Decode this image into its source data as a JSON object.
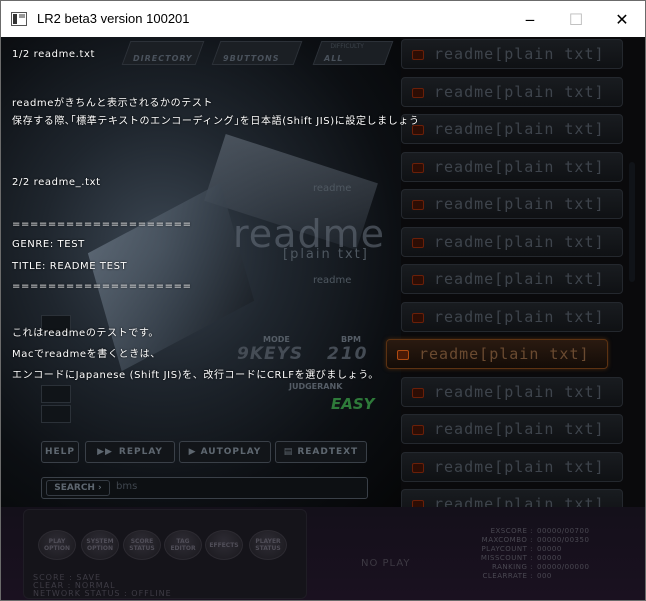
{
  "window": {
    "title": "LR2 beta3 version 100201",
    "minimize_glyph": "‒",
    "maximize_glyph": "☐",
    "close_glyph": "✕"
  },
  "header_tabs": [
    {
      "small": "",
      "label": "DIRECTORY"
    },
    {
      "small": "",
      "label": "9BUTTONS"
    },
    {
      "small": "DIFFICULTY",
      "label": "ALL"
    }
  ],
  "overlay_lines": [
    "1/2 readme.txt",
    "readmeがきちんと表示されるかのテスト",
    "保存する際､｢標準テキストのエンコーディング｣を日本語(Shift JIS)に設定しましょう",
    "2/2 readme_.txt",
    "====================",
    "GENRE: TEST",
    "TITLE: README TEST",
    "====================",
    "これはreadmeのテストです。",
    "Macでreadmeを書くときは、",
    "エンコードにJapanese (Shift JIS)を、改行コードにCRLFを選びましょう。"
  ],
  "song_info": {
    "artist_small": "readme",
    "title": "readme",
    "subtitle": "[plain txt]",
    "genre_small": "readme",
    "mode_label": "MODE",
    "mode_value": "9KEYS",
    "bpm_label": "BPM",
    "bpm_value": "210",
    "judge_label": "JUDGERANK",
    "judge_value": "EASY"
  },
  "controls": {
    "help": "HELP",
    "replay": "REPLAY",
    "autoplay": "AUTOPLAY",
    "readtext": "READTEXT",
    "search_label": "SEARCH",
    "search_value": "bms"
  },
  "song_list": [
    "readme[plain txt]",
    "readme[plain txt]",
    "readme[plain txt]",
    "readme[plain txt]",
    "readme[plain txt]",
    "readme[plain txt]",
    "readme[plain txt]",
    "readme[plain txt]",
    "readme[plain txt]",
    "readme[plain txt]",
    "readme[plain txt]",
    "readme[plain txt]",
    "readme[plain txt]",
    "readme[plain txt]"
  ],
  "selected_index": 8,
  "bottom": {
    "options": [
      "PLAY OPTION",
      "SYSTEM OPTION",
      "SCORE STATUS",
      "TAG EDITOR",
      "EFFECTS",
      "PLAYER STATUS"
    ],
    "score_line": "SCORE : SAVE",
    "clear_line": "CLEAR : NORMAL",
    "network_line": "NETWORK STATUS : OFFLINE",
    "no_play": "NO PLAY",
    "stats": [
      {
        "k": "EXSCORE :",
        "v": "00000/00700"
      },
      {
        "k": "MAXCOMBO :",
        "v": "00000/00350"
      },
      {
        "k": "PLAYCOUNT :",
        "v": "00000"
      },
      {
        "k": "MISSCOUNT :",
        "v": "00000"
      },
      {
        "k": "RANKING :",
        "v": "00000/00000"
      },
      {
        "k": "CLEARRATE :",
        "v": "000"
      }
    ]
  },
  "colors": {
    "accent_selected": "#b04a10",
    "judge_easy": "#2e7a3a"
  }
}
